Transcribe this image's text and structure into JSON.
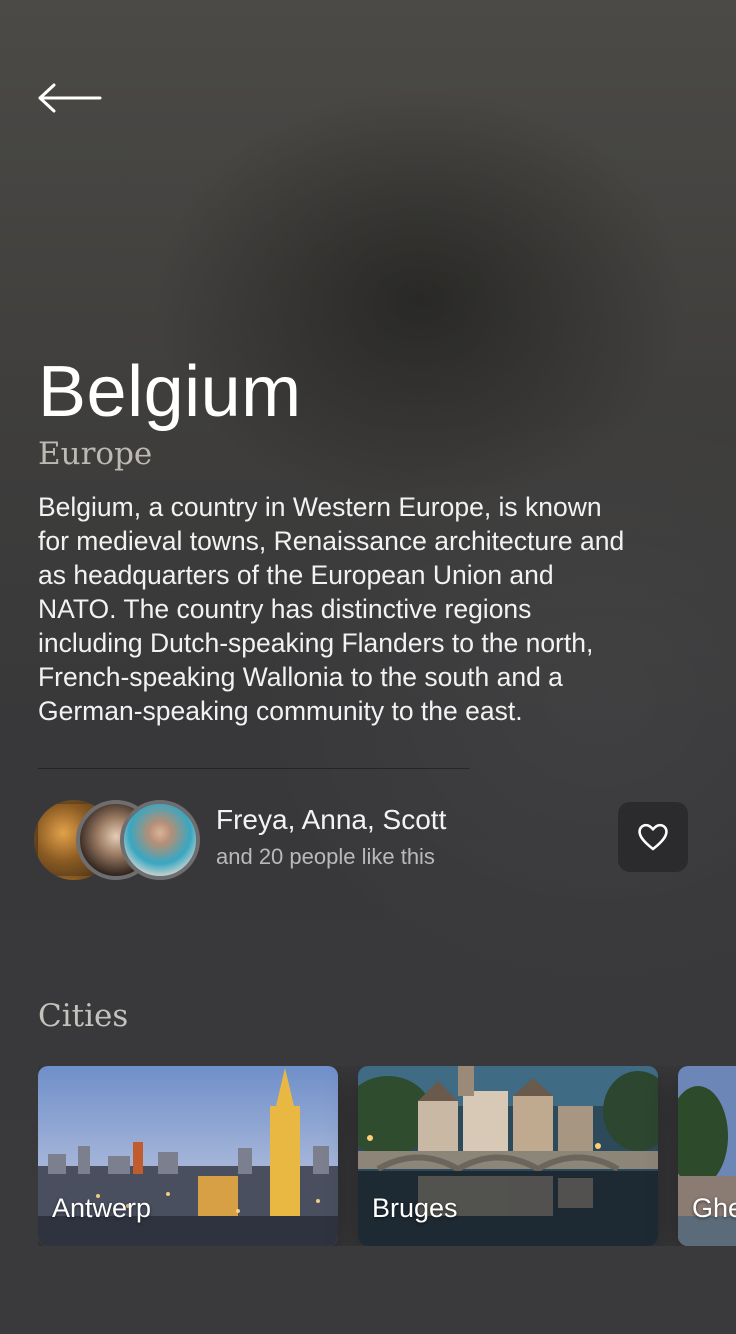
{
  "header": {
    "back_icon": "arrow-left-icon"
  },
  "country": {
    "name": "Belgium",
    "region": "Europe",
    "description": "Belgium, a country in Western Europe, is known for medieval towns, Renaissance architecture and as headquarters of the European Union and NATO. The country has distinctive regions including Dutch-speaking Flanders to the north, French-speaking Wallonia to the south and a German-speaking community to the east."
  },
  "likes": {
    "names": "Freya, Anna, Scott",
    "summary": "and 20 people like this",
    "favorite_icon": "heart-icon"
  },
  "cities": {
    "title": "Cities",
    "items": [
      {
        "name": "Antwerp"
      },
      {
        "name": "Bruges"
      },
      {
        "name": "Ghe"
      }
    ]
  },
  "colors": {
    "background": "#3f3e3c",
    "favorite_button": "#2b2b2d",
    "subtitle": "#bdbab5"
  }
}
